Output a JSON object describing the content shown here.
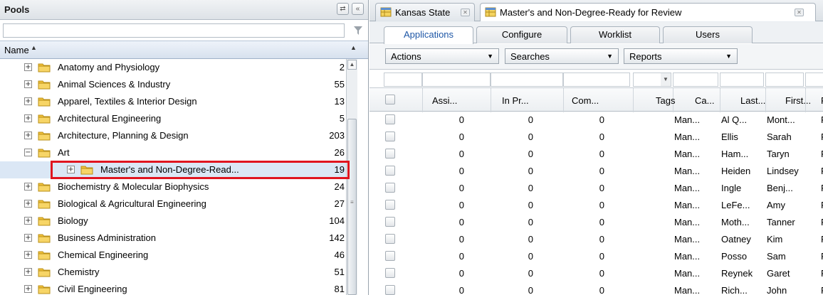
{
  "left_panel": {
    "title": "Pools",
    "header_buttons": [
      "⇄",
      "«"
    ],
    "filter_placeholder": "",
    "column_name": "Name",
    "tree": [
      {
        "label": "Anatomy and Physiology",
        "count": "2",
        "expander": "+",
        "level": 1
      },
      {
        "label": "Animal Sciences & Industry",
        "count": "55",
        "expander": "+",
        "level": 1
      },
      {
        "label": "Apparel, Textiles & Interior Design",
        "count": "13",
        "expander": "+",
        "level": 1
      },
      {
        "label": "Architectural Engineering",
        "count": "5",
        "expander": "+",
        "level": 1
      },
      {
        "label": "Architecture, Planning & Design",
        "count": "203",
        "expander": "+",
        "level": 1
      },
      {
        "label": "Art",
        "count": "26",
        "expander": "−",
        "level": 1
      },
      {
        "label": "Master's and Non-Degree-Read...",
        "count": "19",
        "expander": "+",
        "level": 2,
        "selected": true
      },
      {
        "label": "Biochemistry & Molecular Biophysics",
        "count": "24",
        "expander": "+",
        "level": 1
      },
      {
        "label": "Biological & Agricultural Engineering",
        "count": "27",
        "expander": "+",
        "level": 1
      },
      {
        "label": "Biology",
        "count": "104",
        "expander": "+",
        "level": 1
      },
      {
        "label": "Business Administration",
        "count": "142",
        "expander": "+",
        "level": 1
      },
      {
        "label": "Chemical Engineering",
        "count": "46",
        "expander": "+",
        "level": 1
      },
      {
        "label": "Chemistry",
        "count": "51",
        "expander": "+",
        "level": 1
      },
      {
        "label": "Civil Engineering",
        "count": "81",
        "expander": "+",
        "level": 1
      }
    ]
  },
  "doc_tabs": [
    {
      "label": "Kansas State",
      "active": false
    },
    {
      "label": "Master's and Non-Degree-Ready for Review",
      "active": true
    }
  ],
  "sub_tabs": [
    "Applications",
    "Configure",
    "Worklist",
    "Users"
  ],
  "toolbar": {
    "actions": "Actions",
    "searches": "Searches",
    "reports": "Reports"
  },
  "grid": {
    "headers": [
      "Assi...",
      "In Pr...",
      "Com...",
      "Tags",
      "Ca...",
      "Last...",
      "First...",
      "F"
    ],
    "rows": [
      [
        "0",
        "0",
        "0",
        "Man...",
        "Al Q...",
        "Mont...",
        "F"
      ],
      [
        "0",
        "0",
        "0",
        "Man...",
        "Ellis",
        "Sarah",
        "F"
      ],
      [
        "0",
        "0",
        "0",
        "Man...",
        "Ham...",
        "Taryn",
        "F"
      ],
      [
        "0",
        "0",
        "0",
        "Man...",
        "Heiden",
        "Lindsey",
        "F"
      ],
      [
        "0",
        "0",
        "0",
        "Man...",
        "Ingle",
        "Benj...",
        "F"
      ],
      [
        "0",
        "0",
        "0",
        "Man...",
        "LeFe...",
        "Amy",
        "F"
      ],
      [
        "0",
        "0",
        "0",
        "Man...",
        "Moth...",
        "Tanner",
        "F"
      ],
      [
        "0",
        "0",
        "0",
        "Man...",
        "Oatney",
        "Kim",
        "F"
      ],
      [
        "0",
        "0",
        "0",
        "Man...",
        "Posso",
        "Sam",
        "F"
      ],
      [
        "0",
        "0",
        "0",
        "Man...",
        "Reynek",
        "Garet",
        "F"
      ],
      [
        "0",
        "0",
        "0",
        "Man...",
        "Rich...",
        "John",
        "F"
      ]
    ]
  },
  "colors": {
    "highlight": "#e0151f",
    "selected_row": "#dbe7f5",
    "active_tab_text": "#1d56a6",
    "folder": "#f2c23a"
  }
}
